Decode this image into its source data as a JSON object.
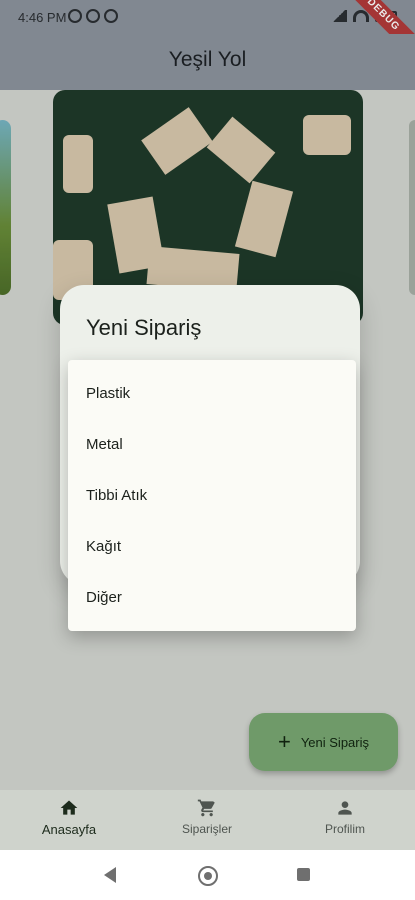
{
  "status_bar": {
    "time": "4:46 PM",
    "debug_label": "DEBUG"
  },
  "app_bar": {
    "title": "Yeşil Yol"
  },
  "dialog": {
    "title": "Yeni Sipariş"
  },
  "dropdown": {
    "items": [
      "Plastik",
      "Metal",
      "Tibbi Atık",
      "Kağıt",
      "Diğer"
    ]
  },
  "fab": {
    "label": "Yeni Sipariş"
  },
  "bottom_nav": {
    "items": [
      {
        "label": "Anasayfa",
        "icon": "home-icon"
      },
      {
        "label": "Siparişler",
        "icon": "cart-icon"
      },
      {
        "label": "Profilim",
        "icon": "person-icon"
      }
    ]
  },
  "colors": {
    "app_bar": "#8d949e",
    "fab": "#6f9a69",
    "dialog": "#edf0ea",
    "dropdown": "#fbfbf6"
  }
}
